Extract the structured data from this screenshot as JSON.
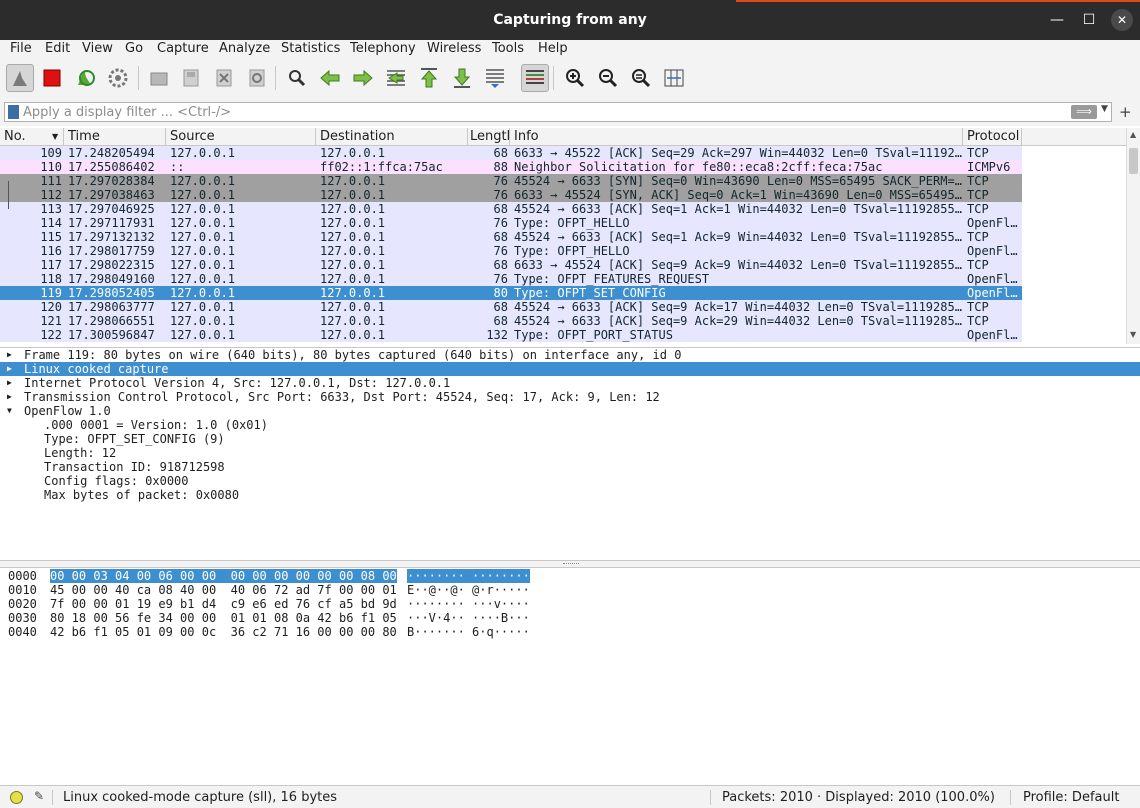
{
  "window": {
    "title": "Capturing from any"
  },
  "menu": [
    "File",
    "Edit",
    "View",
    "Go",
    "Capture",
    "Analyze",
    "Statistics",
    "Telephony",
    "Wireless",
    "Tools",
    "Help"
  ],
  "toolbar": {
    "icons": [
      "shark-fin-icon",
      "stop-icon",
      "restart-icon",
      "options-gear-icon",
      "open-file-icon",
      "save-file-icon",
      "close-file-icon",
      "reload-icon",
      "find-icon",
      "back-icon",
      "forward-icon",
      "goto-packet-icon",
      "first-packet-icon",
      "last-packet-icon",
      "autoscroll-icon",
      "colorize-icon",
      "zoom-in-icon",
      "zoom-out-icon",
      "zoom-normal-icon",
      "resize-columns-icon"
    ]
  },
  "filter": {
    "placeholder": "Apply a display filter ... <Ctrl-/>",
    "apply_label": "⟹"
  },
  "packet_list": {
    "columns": [
      "No.",
      "Time",
      "Source",
      "Destination",
      "Length",
      "Info",
      "Protocol"
    ],
    "rows": [
      {
        "no": "109",
        "time": "17.248205494",
        "src": "127.0.0.1",
        "dst": "127.0.0.1",
        "len": "68",
        "info": "6633 → 45522 [ACK] Seq=29 Ack=297 Win=44032 Len=0 TSval=11192…",
        "proto": "TCP",
        "kind": "tcp"
      },
      {
        "no": "110",
        "time": "17.255086402",
        "src": "::",
        "dst": "ff02::1:ffca:75ac",
        "len": "88",
        "info": "Neighbor Solicitation for fe80::eca8:2cff:feca:75ac",
        "proto": "ICMPv6",
        "kind": "icmp"
      },
      {
        "no": "111",
        "time": "17.297028384",
        "src": "127.0.0.1",
        "dst": "127.0.0.1",
        "len": "76",
        "info": "45524 → 6633 [SYN] Seq=0 Win=43690 Len=0 MSS=65495 SACK_PERM=…",
        "proto": "TCP",
        "kind": "synack"
      },
      {
        "no": "112",
        "time": "17.297038463",
        "src": "127.0.0.1",
        "dst": "127.0.0.1",
        "len": "76",
        "info": "6633 → 45524 [SYN, ACK] Seq=0 Ack=1 Win=43690 Len=0 MSS=65495…",
        "proto": "TCP",
        "kind": "synack"
      },
      {
        "no": "113",
        "time": "17.297046925",
        "src": "127.0.0.1",
        "dst": "127.0.0.1",
        "len": "68",
        "info": "45524 → 6633 [ACK] Seq=1 Ack=1 Win=44032 Len=0 TSval=11192855…",
        "proto": "TCP",
        "kind": "tcp"
      },
      {
        "no": "114",
        "time": "17.297117931",
        "src": "127.0.0.1",
        "dst": "127.0.0.1",
        "len": "76",
        "info": "Type: OFPT_HELLO",
        "proto": "OpenFl…",
        "kind": "tcp"
      },
      {
        "no": "115",
        "time": "17.297132132",
        "src": "127.0.0.1",
        "dst": "127.0.0.1",
        "len": "68",
        "info": "45524 → 6633 [ACK] Seq=1 Ack=9 Win=44032 Len=0 TSval=11192855…",
        "proto": "TCP",
        "kind": "tcp"
      },
      {
        "no": "116",
        "time": "17.298017759",
        "src": "127.0.0.1",
        "dst": "127.0.0.1",
        "len": "76",
        "info": "Type: OFPT_HELLO",
        "proto": "OpenFl…",
        "kind": "tcp"
      },
      {
        "no": "117",
        "time": "17.298022315",
        "src": "127.0.0.1",
        "dst": "127.0.0.1",
        "len": "68",
        "info": "6633 → 45524 [ACK] Seq=9 Ack=9 Win=44032 Len=0 TSval=11192855…",
        "proto": "TCP",
        "kind": "tcp"
      },
      {
        "no": "118",
        "time": "17.298049160",
        "src": "127.0.0.1",
        "dst": "127.0.0.1",
        "len": "76",
        "info": "Type: OFPT_FEATURES_REQUEST",
        "proto": "OpenFl…",
        "kind": "tcp"
      },
      {
        "no": "119",
        "time": "17.298052405",
        "src": "127.0.0.1",
        "dst": "127.0.0.1",
        "len": "80",
        "info": "Type: OFPT_SET_CONFIG",
        "proto": "OpenFl…",
        "kind": "sel"
      },
      {
        "no": "120",
        "time": "17.298063777",
        "src": "127.0.0.1",
        "dst": "127.0.0.1",
        "len": "68",
        "info": "45524 → 6633 [ACK] Seq=9 Ack=17 Win=44032 Len=0 TSval=1119285…",
        "proto": "TCP",
        "kind": "tcp"
      },
      {
        "no": "121",
        "time": "17.298066551",
        "src": "127.0.0.1",
        "dst": "127.0.0.1",
        "len": "68",
        "info": "45524 → 6633 [ACK] Seq=9 Ack=29 Win=44032 Len=0 TSval=1119285…",
        "proto": "TCP",
        "kind": "tcp"
      },
      {
        "no": "122",
        "time": "17.300596847",
        "src": "127.0.0.1",
        "dst": "127.0.0.1",
        "len": "132",
        "info": "Type: OFPT_PORT_STATUS",
        "proto": "OpenFl…",
        "kind": "tcp"
      }
    ]
  },
  "details": [
    {
      "text": "Frame 119: 80 bytes on wire (640 bits), 80 bytes captured (640 bits) on interface any, id 0",
      "arrow": "▶",
      "child": false,
      "sel": false
    },
    {
      "text": "Linux cooked capture",
      "arrow": "▶",
      "child": false,
      "sel": true
    },
    {
      "text": "Internet Protocol Version 4, Src: 127.0.0.1, Dst: 127.0.0.1",
      "arrow": "▶",
      "child": false,
      "sel": false
    },
    {
      "text": "Transmission Control Protocol, Src Port: 6633, Dst Port: 45524, Seq: 17, Ack: 9, Len: 12",
      "arrow": "▶",
      "child": false,
      "sel": false
    },
    {
      "text": "OpenFlow 1.0",
      "arrow": "▼",
      "child": false,
      "sel": false
    },
    {
      "text": ".000 0001 = Version: 1.0 (0x01)",
      "arrow": "",
      "child": true,
      "sel": false
    },
    {
      "text": "Type: OFPT_SET_CONFIG (9)",
      "arrow": "",
      "child": true,
      "sel": false
    },
    {
      "text": "Length: 12",
      "arrow": "",
      "child": true,
      "sel": false
    },
    {
      "text": "Transaction ID: 918712598",
      "arrow": "",
      "child": true,
      "sel": false
    },
    {
      "text": "Config flags: 0x0000",
      "arrow": "",
      "child": true,
      "sel": false
    },
    {
      "text": "Max bytes of packet: 0x0080",
      "arrow": "",
      "child": true,
      "sel": false
    }
  ],
  "bytes": [
    {
      "offset": "0000",
      "hex": "00 00 03 04 00 06 00 00  00 00 00 00 00 00 08 00",
      "ascii": "········ ········",
      "highlight": true
    },
    {
      "offset": "0010",
      "hex": "45 00 00 40 ca 08 40 00  40 06 72 ad 7f 00 00 01",
      "ascii": "E··@··@· @·r·····",
      "highlight": false
    },
    {
      "offset": "0020",
      "hex": "7f 00 00 01 19 e9 b1 d4  c9 e6 ed 76 cf a5 bd 9d",
      "ascii": "········ ···v····",
      "highlight": false
    },
    {
      "offset": "0030",
      "hex": "80 18 00 56 fe 34 00 00  01 01 08 0a 42 b6 f1 05",
      "ascii": "···V·4·· ····B···",
      "highlight": false
    },
    {
      "offset": "0040",
      "hex": "42 b6 f1 05 01 09 00 0c  36 c2 71 16 00 00 00 80",
      "ascii": "B······· 6·q·····",
      "highlight": false
    }
  ],
  "status": {
    "message": "Linux cooked-mode capture (sll), 16 bytes",
    "packets": "Packets: 2010 · Displayed: 2010 (100.0%)",
    "profile": "Profile: Default"
  },
  "colors": {
    "selection": "#3d8fd0",
    "tcp_row": "#e7e6ff",
    "icmp_row": "#fce0ff",
    "syn_row": "#a0a0a0"
  }
}
